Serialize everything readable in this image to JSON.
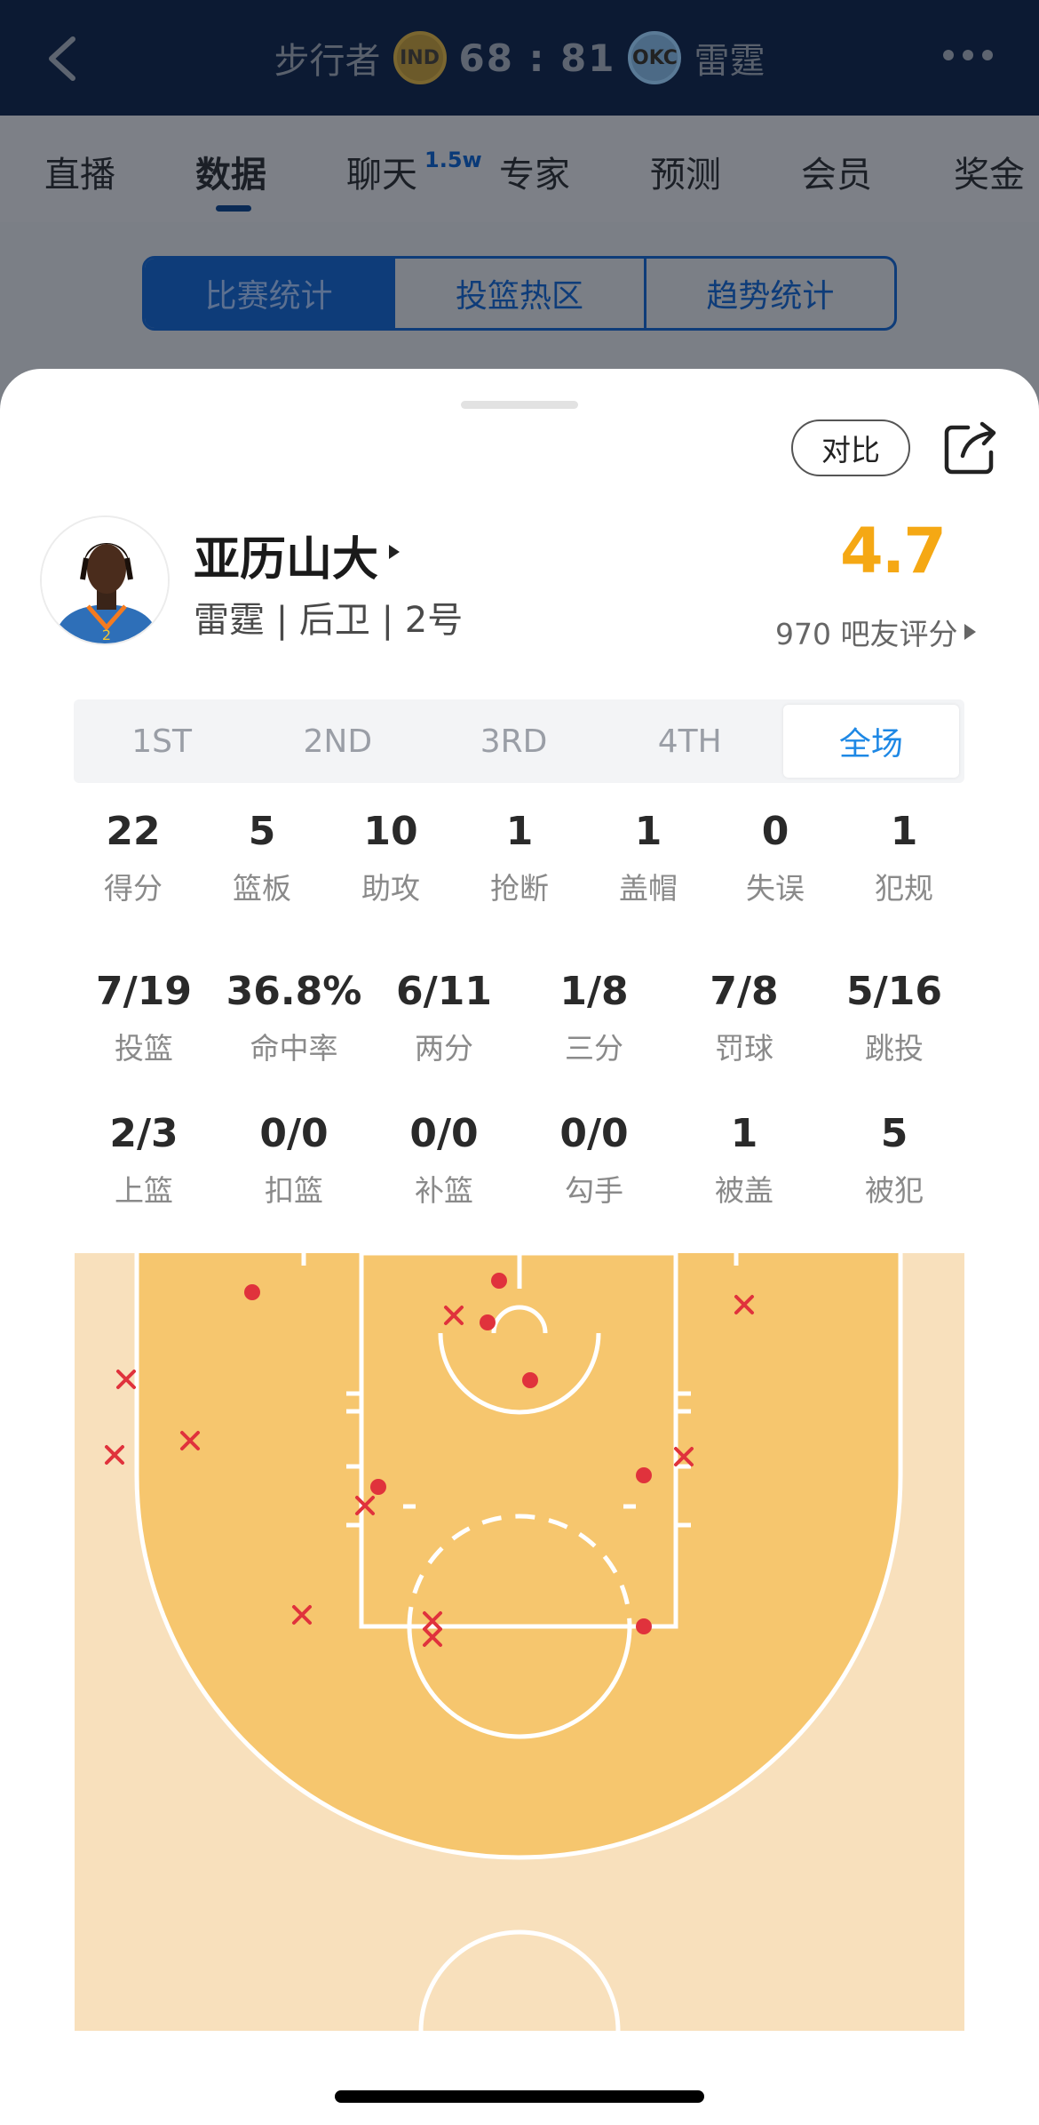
{
  "header": {
    "away_team": "步行者",
    "away_logo_text": "IND",
    "score": "68 : 81",
    "home_logo_text": "OKC",
    "home_team": "雷霆"
  },
  "nav": {
    "tabs": [
      "直播",
      "数据",
      "聊天",
      "专家",
      "预测",
      "会员",
      "奖金"
    ],
    "chat_badge": "1.5w",
    "active": "数据"
  },
  "segment": {
    "items": [
      "比赛统计",
      "投篮热区",
      "趋势统计"
    ],
    "active": "比赛统计"
  },
  "sheet": {
    "compare_label": "对比",
    "player_name": "亚历山大",
    "player_sub": "雷霆 | 后卫 | 2号",
    "rating": "4.7",
    "rating_label": "970 吧友评分"
  },
  "periods": {
    "items": [
      "1ST",
      "2ND",
      "3RD",
      "4TH",
      "全场"
    ],
    "active": "全场"
  },
  "stats_row1": [
    {
      "value": "22",
      "label": "得分"
    },
    {
      "value": "5",
      "label": "篮板"
    },
    {
      "value": "10",
      "label": "助攻"
    },
    {
      "value": "1",
      "label": "抢断"
    },
    {
      "value": "1",
      "label": "盖帽"
    },
    {
      "value": "0",
      "label": "失误"
    },
    {
      "value": "1",
      "label": "犯规"
    }
  ],
  "stats_row2": [
    {
      "value": "7/19",
      "label": "投篮"
    },
    {
      "value": "36.8%",
      "label": "命中率"
    },
    {
      "value": "6/11",
      "label": "两分"
    },
    {
      "value": "1/8",
      "label": "三分"
    },
    {
      "value": "7/8",
      "label": "罚球"
    },
    {
      "value": "5/16",
      "label": "跳投"
    }
  ],
  "stats_row3": [
    {
      "value": "2/3",
      "label": "上篮"
    },
    {
      "value": "0/0",
      "label": "扣篮"
    },
    {
      "value": "0/0",
      "label": "补篮"
    },
    {
      "value": "0/0",
      "label": "勾手"
    },
    {
      "value": "1",
      "label": "被盖"
    },
    {
      "value": "5",
      "label": "被犯"
    }
  ],
  "colors": {
    "made": "#e0323c",
    "missed": "#e0323c",
    "court_inner": "#f6c66e",
    "court_outer": "#f8e0bc",
    "rating": "#f5a814",
    "accent": "#1e88e5"
  }
}
